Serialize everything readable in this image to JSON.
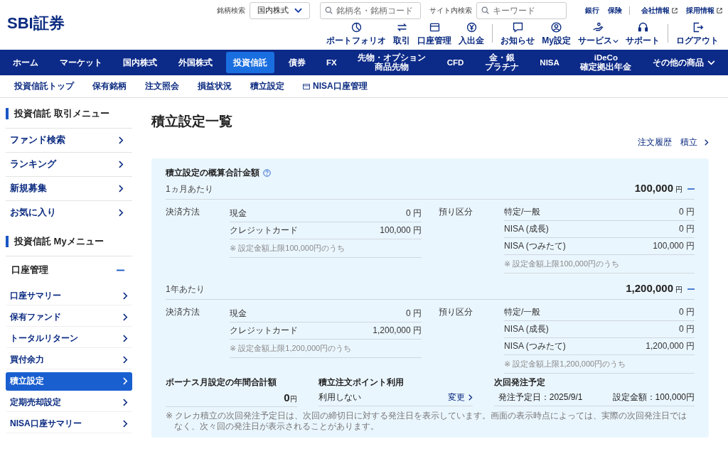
{
  "logo": "SBI証券",
  "header_search": {
    "brand_label": "銘柄検索",
    "market_select": "国内株式",
    "brand_placeholder": "銘柄名・銘柄コード",
    "site_label": "サイト内検索",
    "site_placeholder": "キーワード"
  },
  "top_links": [
    {
      "label": "銀行",
      "external": false
    },
    {
      "label": "保険",
      "external": false
    },
    {
      "label": "会社情報",
      "external": true
    },
    {
      "label": "採用情報",
      "external": true
    }
  ],
  "tools": [
    {
      "label": "ポートフォリオ",
      "kind": "pie",
      "caret": false
    },
    {
      "label": "取引",
      "kind": "arrows",
      "caret": false
    },
    {
      "label": "口座管理",
      "kind": "card",
      "caret": false
    },
    {
      "label": "入出金",
      "kind": "yen",
      "caret": false
    },
    {
      "label": "お知らせ",
      "kind": "chat",
      "caret": false
    },
    {
      "label": "My設定",
      "kind": "user",
      "caret": false
    },
    {
      "label": "サービス",
      "kind": "hand",
      "caret": true
    },
    {
      "label": "サポート",
      "kind": "headset",
      "caret": false
    },
    {
      "label": "ログアウト",
      "kind": "logout",
      "caret": false
    }
  ],
  "main_nav": [
    {
      "lines": [
        "ホーム"
      ],
      "selected": false,
      "caret": false
    },
    {
      "lines": [
        "マーケット"
      ],
      "selected": false,
      "caret": false
    },
    {
      "lines": [
        "国内株式"
      ],
      "selected": false,
      "caret": false
    },
    {
      "lines": [
        "外国株式"
      ],
      "selected": false,
      "caret": false
    },
    {
      "lines": [
        "投資信託"
      ],
      "selected": true,
      "caret": false
    },
    {
      "lines": [
        "債券"
      ],
      "selected": false,
      "caret": false
    },
    {
      "lines": [
        "FX"
      ],
      "selected": false,
      "caret": false
    },
    {
      "lines": [
        "先物・オプション",
        "商品先物"
      ],
      "selected": false,
      "caret": false
    },
    {
      "lines": [
        "CFD"
      ],
      "selected": false,
      "caret": false
    },
    {
      "lines": [
        "金・銀",
        "プラチナ"
      ],
      "selected": false,
      "caret": false
    },
    {
      "lines": [
        "NISA"
      ],
      "selected": false,
      "caret": false
    },
    {
      "lines": [
        "iDeCo",
        "確定拠出年金"
      ],
      "selected": false,
      "caret": false
    },
    {
      "lines": [
        "その他の商品"
      ],
      "selected": false,
      "caret": true
    }
  ],
  "sub_nav": [
    {
      "label": "投資信託トップ",
      "card_icon": false
    },
    {
      "label": "保有銘柄",
      "card_icon": false
    },
    {
      "label": "注文照会",
      "card_icon": false
    },
    {
      "label": "損益状況",
      "card_icon": false
    },
    {
      "label": "積立設定",
      "card_icon": false
    },
    {
      "label": "NISA口座管理",
      "card_icon": true
    }
  ],
  "sidebar": {
    "trade_menu": {
      "title": "投資信託 取引メニュー",
      "items": [
        {
          "label": "ファンド検索"
        },
        {
          "label": "ランキング"
        },
        {
          "label": "新規募集"
        },
        {
          "label": "お気に入り"
        }
      ]
    },
    "my_menu": {
      "title": "投資信託 Myメニュー",
      "group": {
        "label": "口座管理",
        "expanded": true,
        "children": [
          {
            "label": "口座サマリー",
            "selected": false
          },
          {
            "label": "保有ファンド",
            "selected": false
          },
          {
            "label": "トータルリターン",
            "selected": false
          },
          {
            "label": "買付余力",
            "selected": false
          },
          {
            "label": "積立設定",
            "selected": true
          },
          {
            "label": "定期売却設定",
            "selected": false
          },
          {
            "label": "NISA口座サマリー",
            "selected": false
          }
        ]
      }
    }
  },
  "page_title": "積立設定一覧",
  "page_links": [
    {
      "label": "注文履歴",
      "chevron": false
    },
    {
      "label": "積立",
      "chevron": true
    }
  ],
  "summary": {
    "title": "積立設定の概算合計金額",
    "periods": [
      {
        "label": "1ヵ月あたり",
        "total": "100,000",
        "unit": "円",
        "expanded": true,
        "payment_label": "決済方法",
        "payments": [
          {
            "name": "現金",
            "amount": "0 円"
          },
          {
            "name": "クレジットカード",
            "amount": "100,000 円"
          }
        ],
        "payment_note": "※ 設定金額上限100,000円のうち",
        "account_label": "預り区分",
        "accounts": [
          {
            "name": "特定/一般",
            "amount": "0 円"
          },
          {
            "name": "NISA (成長)",
            "amount": "0 円"
          },
          {
            "name": "NISA (つみたて)",
            "amount": "100,000 円"
          }
        ],
        "account_note": "※ 設定金額上限100,000円のうち"
      },
      {
        "label": "1年あたり",
        "total": "1,200,000",
        "unit": "円",
        "expanded": true,
        "payment_label": "決済方法",
        "payments": [
          {
            "name": "現金",
            "amount": "0 円"
          },
          {
            "name": "クレジットカード",
            "amount": "1,200,000 円"
          }
        ],
        "payment_note": "※ 設定金額上限1,200,000円のうち",
        "account_label": "預り区分",
        "accounts": [
          {
            "name": "特定/一般",
            "amount": "0 円"
          },
          {
            "name": "NISA (成長)",
            "amount": "0 円"
          },
          {
            "name": "NISA (つみたて)",
            "amount": "1,200,000 円"
          }
        ],
        "account_note": "※ 設定金額上限1,200,000円のうち"
      }
    ],
    "bonus": {
      "title": "ボーナス月設定の年間合計額",
      "amount": "0",
      "unit": "円"
    },
    "points": {
      "title": "積立注文ポイント利用",
      "value": "利用しない",
      "link": "変更"
    },
    "next_order": {
      "title": "次回発注予定",
      "date": "発注予定日：2025/9/1",
      "amount": "設定金額：100,000円"
    },
    "footnote": "※ クレカ積立の次回発注予定日は、次回の締切日に対する発注日を表示しています。画面の表示時点によっては、実際の次回発注日ではなく、次々回の発注日が表示されることがあります。"
  }
}
